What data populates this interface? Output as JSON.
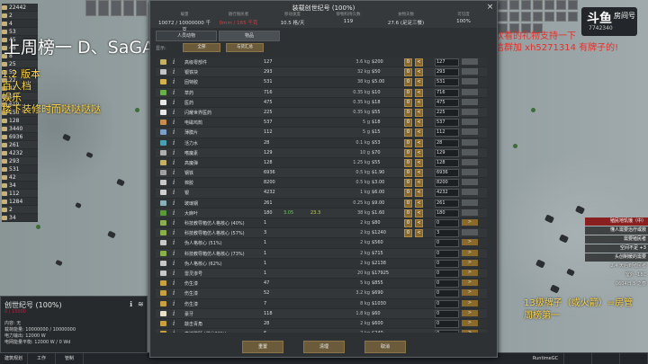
{
  "resources": [
    "22442",
    "2",
    "4",
    "53",
    "45",
    "48",
    "8",
    "25",
    "52",
    "22",
    "41",
    "127",
    "619",
    "150",
    "128",
    "3440",
    "6936",
    "261",
    "4232",
    "293",
    "531",
    "42",
    "34",
    "112",
    "1284",
    "2",
    "34"
  ],
  "overlays": {
    "title": "上周榜一 D、SaGA",
    "left_lines": [
      "1.2 版本",
      "百人档",
      "娱乐",
      "楼下装修时而哒哒哒哒"
    ],
    "right_lines": [
      "喜欢看的礼物支持一下",
      "微信群加 xh5271314 有牌子的!"
    ],
    "bottom_right_lines": [
      "13级牌子（或火箭）=房管",
      "周榜第一"
    ]
  },
  "logo": {
    "brand": "斗鱼",
    "sub": "房间号",
    "room": "7742340"
  },
  "alerts": [
    {
      "text": "殖民地饥饿（中）",
      "style": "red"
    },
    {
      "text": "懂人需要治疗或救",
      "style": "dark"
    },
    {
      "text": "需要殖民者",
      "style": "dark"
    },
    {
      "text": "空间不足 +3",
      "style": "dark"
    },
    {
      "text": "头创制暖的需要",
      "style": "dark"
    },
    {
      "text": "2.4 天后到殖民者",
      "style": "plain"
    },
    {
      "text": "室外 -18C",
      "style": "plain"
    },
    {
      "text": "0604日 5 之春",
      "style": "plain"
    }
  ],
  "inspect": {
    "title": "创世纪号 (100%)",
    "subtitle": "0 / 15000",
    "lines": [
      "内容: 无",
      "载荷能量: 10000000 / 10000000",
      "电力输出: 12000 W",
      "电网能量平衡: 12000 W / 0 Wd"
    ]
  },
  "bottombar": {
    "left": [
      "建筑规划",
      "工作",
      "管制"
    ],
    "right": [
      "RuntimeGC",
      "",
      "",
      ""
    ]
  },
  "dialog": {
    "title": "装载创世纪号 (100%)",
    "close_label": "×",
    "stats": [
      {
        "k": "载量",
        "v": "10072 / 10000000 千克",
        "red": false
      },
      {
        "k": "随行殖民者",
        "v": "0mm / 165 千克",
        "red": true
      },
      {
        "k": "移动速度",
        "v": "10.5 格/天",
        "red": false
      },
      {
        "k": "够物料持久数",
        "v": "119",
        "red": false
      },
      {
        "k": "食物天数",
        "v": "27.6 (足足三餐)",
        "red": false
      },
      {
        "k": "可见度",
        "v": "100%",
        "red": false
      }
    ],
    "tabs": [
      "人员动物",
      "物品"
    ],
    "filter_label": "显示:",
    "filter_buttons": [
      "全部",
      "与货汇总"
    ],
    "footer": [
      "重置",
      "清理",
      "取消"
    ],
    "rows": [
      {
        "name": "高级零部件",
        "count": "127",
        "g1": "",
        "g2": "",
        "mass": "3.6 kg",
        "val": "$200",
        "icon": "#c5b068",
        "mode": "full",
        "amount": "127"
      },
      {
        "name": "银铁块",
        "count": "293",
        "mass": "32 kg",
        "val": "$50",
        "icon": "#c5c5c5",
        "mode": "full",
        "amount": "293"
      },
      {
        "name": "固特胶",
        "count": "531",
        "mass": "38 kg",
        "val": "$5.00",
        "icon": "#d6b24a",
        "mode": "full",
        "amount": "531"
      },
      {
        "name": "草药",
        "count": "716",
        "mass": "0.35 kg",
        "val": "$10",
        "icon": "#6ab04a",
        "mode": "full",
        "amount": "716"
      },
      {
        "name": "医药",
        "count": "475",
        "mass": "0.35 kg",
        "val": "$18",
        "icon": "#e8e8e8",
        "mode": "full",
        "amount": "475"
      },
      {
        "name": "闪耀世界医药",
        "count": "225",
        "mass": "0.35 kg",
        "val": "$55",
        "icon": "#e8e8e8",
        "mode": "full",
        "amount": "225"
      },
      {
        "name": "电磁鸡鹄",
        "count": "537",
        "mass": "5 g",
        "val": "$18",
        "icon": "#c88e4a",
        "mode": "full",
        "amount": "537"
      },
      {
        "name": "薄膜片",
        "count": "112",
        "mass": "5 g",
        "val": "$15",
        "icon": "#7ea0c8",
        "mode": "full",
        "amount": "112"
      },
      {
        "name": "活力水",
        "count": "28",
        "mass": "0.1 kg",
        "val": "$53",
        "icon": "#4aa0b0",
        "mode": "full",
        "amount": "28"
      },
      {
        "name": "嗜魔素",
        "count": "129",
        "mass": "10 g",
        "val": "$70",
        "icon": "#b0b0b0",
        "mode": "full",
        "amount": "129"
      },
      {
        "name": "高魔弹",
        "count": "128",
        "mass": "1.25 kg",
        "val": "$55",
        "icon": "#c5b068",
        "mode": "full",
        "amount": "128"
      },
      {
        "name": "钢铁",
        "count": "6936",
        "mass": "0.5 kg",
        "val": "$1.90",
        "icon": "#a0a0a0",
        "mode": "full",
        "amount": "6936"
      },
      {
        "name": "棉胶",
        "count": "8200",
        "mass": "0.5 kg",
        "val": "$3.00",
        "icon": "#c8c8c8",
        "mode": "full",
        "amount": "8200"
      },
      {
        "name": "银",
        "count": "4232",
        "mass": "1 kg",
        "val": "$6.00",
        "icon": "#d0d0d0",
        "mode": "full",
        "amount": "4232"
      },
      {
        "name": "玻璃钢",
        "count": "261",
        "mass": "0.25 kg",
        "val": "$9.00",
        "icon": "#8ab0b8",
        "mode": "full",
        "amount": "261"
      },
      {
        "name": "大麻叶",
        "count": "180",
        "g1": "3.05",
        "g2": "23.3",
        "mass": "38 kg",
        "val": "$1.60",
        "icon": "#5a9a3a",
        "mode": "full",
        "amount": "180"
      },
      {
        "name": "科技教导箱仿人格核心 (40%)",
        "count": "1",
        "mass": "2 kg",
        "val": "$80",
        "icon": "#8ab04a",
        "mode": "half",
        "amount": "0"
      },
      {
        "name": "科技教导箱仿人格核心 (57%)",
        "count": "3",
        "mass": "2 kg",
        "val": "$1240",
        "icon": "#8ab04a",
        "mode": "full",
        "amount": "3"
      },
      {
        "name": "伪人格核心 (51%)",
        "count": "1",
        "mass": "2 kg",
        "val": "$560",
        "icon": "#c8c8c8",
        "mode": "arrow",
        "amount": "0"
      },
      {
        "name": "科技教导箱仿人格核心 (73%)",
        "count": "1",
        "mass": "2 kg",
        "val": "$715",
        "icon": "#8ab04a",
        "mode": "arrow",
        "amount": "0"
      },
      {
        "name": "伪人格核心 (62%)",
        "count": "1",
        "mass": "2 kg",
        "val": "$2138",
        "icon": "#c8c8c8",
        "mode": "arrow",
        "amount": "0"
      },
      {
        "name": "雷灵渗号",
        "count": "1",
        "mass": "20 kg",
        "val": "$17925",
        "icon": "#c8c8c8",
        "mode": "arrow",
        "amount": "0"
      },
      {
        "name": "伤生漆",
        "count": "47",
        "mass": "5 kg",
        "val": "$855",
        "icon": "#c8a040",
        "mode": "arrow",
        "amount": "0"
      },
      {
        "name": "伤生漆",
        "count": "52",
        "mass": "3.2 kg",
        "val": "$690",
        "icon": "#c8a040",
        "mode": "arrow",
        "amount": "0"
      },
      {
        "name": "伤生漆",
        "count": "7",
        "mass": "8 kg",
        "val": "$1030",
        "icon": "#c8a040",
        "mode": "arrow",
        "amount": "0"
      },
      {
        "name": "豪牙",
        "count": "118",
        "mass": "1.8 kg",
        "val": "$60",
        "icon": "#e8e0c8",
        "mode": "arrow",
        "amount": "0"
      },
      {
        "name": "敲击青角",
        "count": "28",
        "mass": "2 kg",
        "val": "$600",
        "icon": "#c8a040",
        "mode": "arrow",
        "amount": "0"
      },
      {
        "name": "高速跳跃 (满分30%)",
        "count": "6",
        "mass": "2 kg",
        "val": "$240",
        "icon": "#c8a040",
        "mode": "arrow",
        "amount": "0"
      }
    ]
  }
}
